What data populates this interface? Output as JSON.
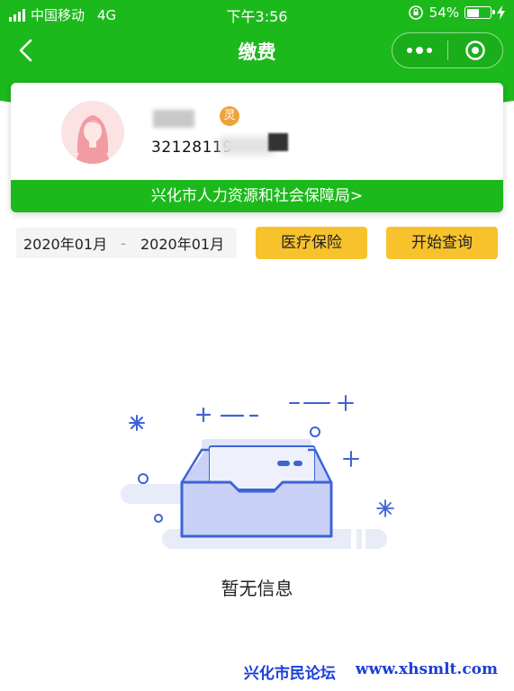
{
  "status_bar": {
    "carrier": "中国移动",
    "network": "4G",
    "time": "下午3:56",
    "battery": "54%",
    "battery_level": 0.54
  },
  "nav": {
    "title": "缴费",
    "back_icon": "chevron-left-icon",
    "more_icon": "more-dots-icon",
    "close_icon": "target-close-icon"
  },
  "user_card": {
    "badge": "灵",
    "id_number": "32128119",
    "organization": "兴化市人力资源和社会保障局>"
  },
  "query": {
    "start_date": "2020年01月",
    "separator": "-",
    "end_date": "2020年01月",
    "insurance_type": "医疗保险",
    "search_button": "开始查询"
  },
  "empty_state": {
    "message": "暂无信息"
  },
  "watermark": {
    "forum": "兴化市民论坛",
    "url": "www.xhsmlt.com"
  },
  "colors": {
    "brand_green": "#1cb91c",
    "button_yellow": "#f7c22c",
    "watermark_blue": "#1a3fd8"
  }
}
